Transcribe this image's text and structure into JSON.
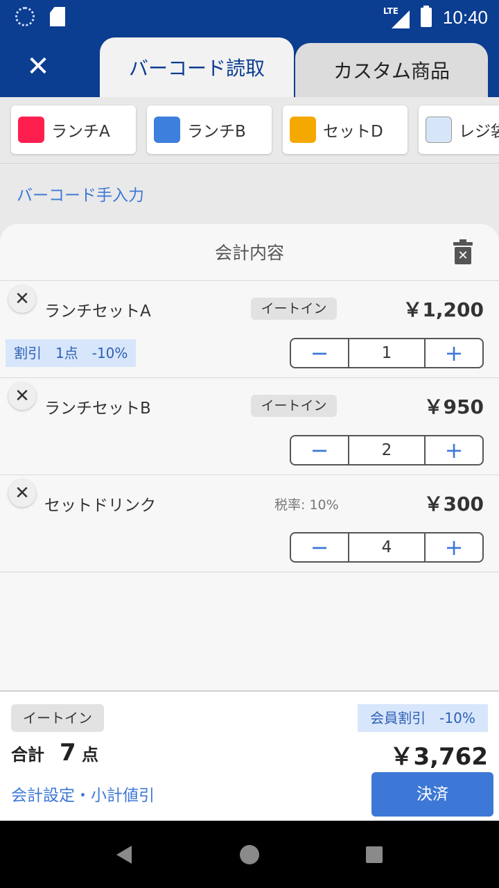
{
  "status_bar": {
    "network": "LTE",
    "time": "10:40"
  },
  "header": {
    "close_label": "✕",
    "tabs": [
      {
        "label": "バーコード読取",
        "active": true
      },
      {
        "label": "カスタム商品",
        "active": false
      }
    ]
  },
  "quick_items": [
    {
      "label": "ランチA",
      "color": "#ff1f4f"
    },
    {
      "label": "ランチB",
      "color": "#3d7fdc"
    },
    {
      "label": "セットD",
      "color": "#f5a800"
    },
    {
      "label": "レジ袋",
      "color": "#d6e6f8"
    }
  ],
  "manual_entry": "バーコード手入力",
  "sheet": {
    "title": "会計内容",
    "items": [
      {
        "name": "ランチセットA",
        "badge": "イートイン",
        "price": "￥1,200",
        "discount": "割引　1点　-10%",
        "qty": "1"
      },
      {
        "name": "ランチセットB",
        "badge": "イートイン",
        "price": "￥950",
        "qty": "2"
      },
      {
        "name": "セットドリンク",
        "tax_note": "税率: 10%",
        "price": "￥300",
        "qty": "4"
      }
    ],
    "remove_label": "✕",
    "minus_label": "−",
    "plus_label": "+"
  },
  "footer": {
    "badge": "イートイン",
    "member_discount": "会員割引　-10%",
    "total_label": "合計",
    "count": "7",
    "count_unit": "点",
    "total_amount": "￥3,762",
    "settings_link": "会計設定・小計値引",
    "pay_label": "決済"
  }
}
